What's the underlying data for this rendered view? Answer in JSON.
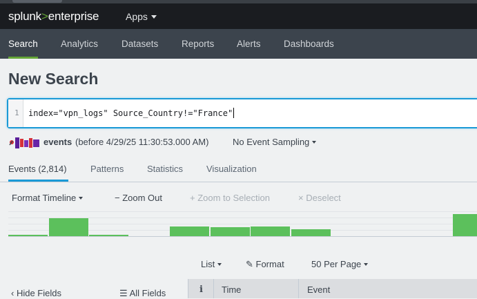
{
  "app": {
    "logo_main": "splunk",
    "logo_sep": ">",
    "logo_suffix": "enterprise",
    "apps_menu": "Apps"
  },
  "nav": {
    "items": [
      "Search",
      "Analytics",
      "Datasets",
      "Reports",
      "Alerts",
      "Dashboards"
    ],
    "active": "Search"
  },
  "page": {
    "title": "New Search"
  },
  "search": {
    "line_number": "1",
    "query": "index=\"vpn_logs\" Source_Country!=\"France\""
  },
  "status": {
    "events_label": "events",
    "time_text": "(before 4/29/25 11:30:53.000 AM)",
    "sampling": "No Event Sampling"
  },
  "result_tabs": {
    "items": [
      "Events (2,814)",
      "Patterns",
      "Statistics",
      "Visualization"
    ],
    "active": "Events (2,814)"
  },
  "timeline_toolbar": {
    "format": "Format Timeline",
    "zoom_out": "Zoom Out",
    "zoom_selection": "Zoom to Selection",
    "deselect": "Deselect"
  },
  "timeline": {
    "bars": [
      0.06,
      0.75,
      0.06,
      0.0,
      0.42,
      0.38,
      0.41,
      0.3,
      0.0,
      0.0,
      0.0,
      0.95
    ],
    "bar_color": "#5cc05c"
  },
  "list_toolbar": {
    "list": "List",
    "format": "Format",
    "per_page": "50 Per Page"
  },
  "fields": {
    "hide": "Hide Fields",
    "all": "All Fields"
  },
  "table": {
    "info_header": "i",
    "time_header": "Time",
    "event_header": "Event"
  },
  "colors": {
    "accent_green": "#65a637",
    "accent_blue": "#1a9ad6",
    "nav_bg": "#3c444d"
  }
}
